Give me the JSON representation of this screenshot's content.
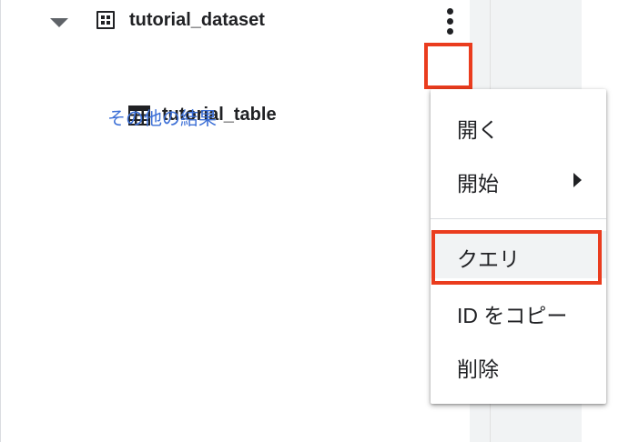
{
  "explorer": {
    "dataset": {
      "name": "tutorial_dataset",
      "icon": "dataset-icon",
      "expanded": true
    },
    "table": {
      "name": "tutorial_table",
      "icon": "table-icon"
    },
    "more_results_label": "その他の結果"
  },
  "context_menu": {
    "items": [
      {
        "label": "開く"
      },
      {
        "label": "開始",
        "has_submenu": true
      },
      {
        "label": "クエリ",
        "highlighted": true
      },
      {
        "label": "ID をコピー"
      },
      {
        "label": "削除"
      }
    ]
  },
  "colors": {
    "highlight_border": "#ea3c1e",
    "link": "#3c6fd6",
    "text": "#202124"
  }
}
